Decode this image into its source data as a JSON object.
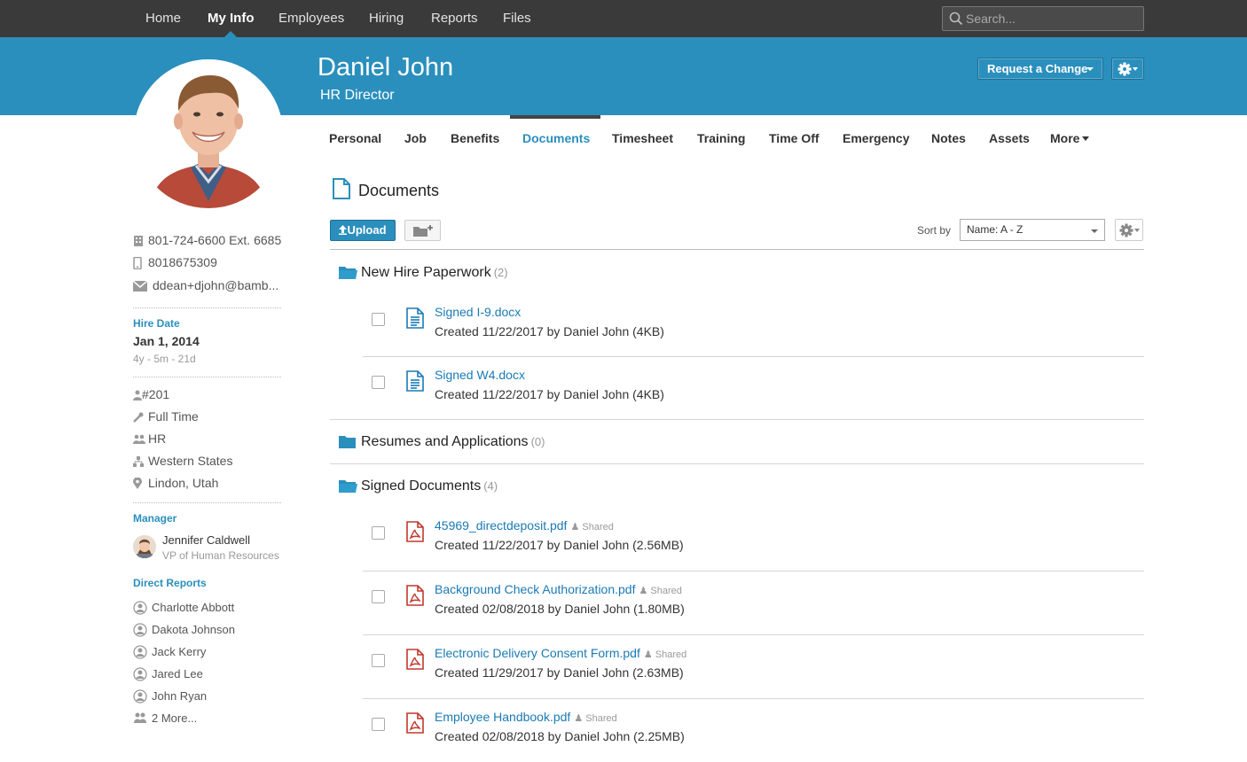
{
  "nav": {
    "items": [
      {
        "label": "Home"
      },
      {
        "label": "My Info"
      },
      {
        "label": "Employees"
      },
      {
        "label": "Hiring"
      },
      {
        "label": "Reports"
      },
      {
        "label": "Files"
      }
    ],
    "active": "My Info",
    "search_placeholder": "Search..."
  },
  "header": {
    "name": "Daniel John",
    "title": "HR Director",
    "request_change_label": "Request a Change",
    "accent_color": "#2a8fbd"
  },
  "sidebar": {
    "phone_work": "801-724-6600 Ext. 6685",
    "phone_mobile": "8018675309",
    "email": "ddean+djohn@bamb...",
    "hire_date_label": "Hire Date",
    "hire_date": "Jan 1, 2014",
    "tenure": "4y - 5m - 21d",
    "employee_number": "#201",
    "employment_type": "Full Time",
    "department": "HR",
    "division": "Western States",
    "location": "Lindon, Utah",
    "manager_label": "Manager",
    "manager_name": "Jennifer Caldwell",
    "manager_title": "VP of Human Resources",
    "direct_reports_label": "Direct Reports",
    "direct_reports": [
      "Charlotte Abbott",
      "Dakota Johnson",
      "Jack Kerry",
      "Jared Lee",
      "John Ryan"
    ],
    "more_reports": "2 More..."
  },
  "tabs": {
    "items": [
      "Personal",
      "Job",
      "Benefits",
      "Documents",
      "Timesheet",
      "Training",
      "Time Off",
      "Emergency",
      "Notes",
      "Assets",
      "More"
    ],
    "active": "Documents"
  },
  "documents": {
    "heading": "Documents",
    "upload_label": "Upload",
    "sort_label": "Sort by",
    "sort_value": "Name: A - Z",
    "folders": [
      {
        "name": "New Hire Paperwork",
        "count": "(2)",
        "files": [
          {
            "name": "Signed I-9.docx",
            "meta": "Created 11/22/2017 by Daniel John (4KB)",
            "type": "doc",
            "shared": ""
          },
          {
            "name": "Signed W4.docx",
            "meta": "Created 11/22/2017 by Daniel John (4KB)",
            "type": "doc",
            "shared": ""
          }
        ]
      },
      {
        "name": "Resumes and Applications",
        "count": "(0)",
        "files": []
      },
      {
        "name": "Signed Documents",
        "count": "(4)",
        "files": [
          {
            "name": "45969_directdeposit.pdf",
            "meta": "Created 11/22/2017 by Daniel John (2.56MB)",
            "type": "pdf",
            "shared": "Shared"
          },
          {
            "name": "Background Check Authorization.pdf",
            "meta": "Created 02/08/2018 by Daniel John (1.80MB)",
            "type": "pdf",
            "shared": "Shared"
          },
          {
            "name": "Electronic Delivery Consent Form.pdf",
            "meta": "Created 11/29/2017 by Daniel John (2.63MB)",
            "type": "pdf",
            "shared": "Shared"
          },
          {
            "name": "Employee Handbook.pdf",
            "meta": "Created 02/08/2018 by Daniel John (2.25MB)",
            "type": "pdf",
            "shared": "Shared"
          }
        ]
      }
    ]
  }
}
